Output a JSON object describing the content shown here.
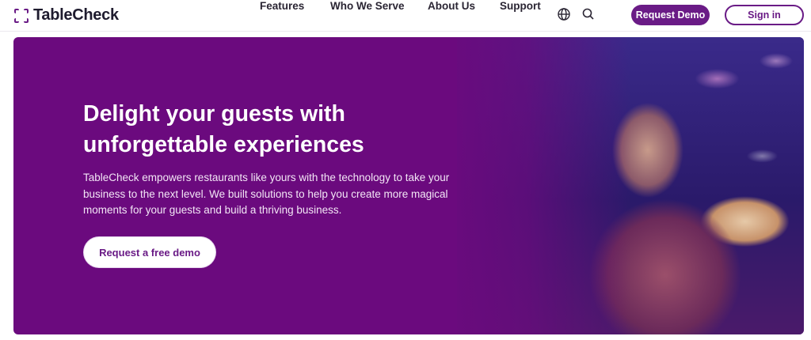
{
  "brand": {
    "name": "TableCheck",
    "color": "#6a1b86"
  },
  "nav": {
    "items": [
      {
        "label": "Features"
      },
      {
        "label": "Who We Serve"
      },
      {
        "label": "About Us"
      },
      {
        "label": "Support"
      }
    ],
    "icons": [
      "globe-icon",
      "search-icon"
    ],
    "request_demo_label": "Request Demo",
    "sign_in_label": "Sign in"
  },
  "hero": {
    "title": "Delight your guests with unforgettable experiences",
    "body": "TableCheck empowers restaurants like yours with the technology to take your business to the next level. We built solutions to help you create more magical moments for your guests and build a thriving business.",
    "cta_label": "Request a free demo",
    "background_color": "#6b0a7e"
  }
}
